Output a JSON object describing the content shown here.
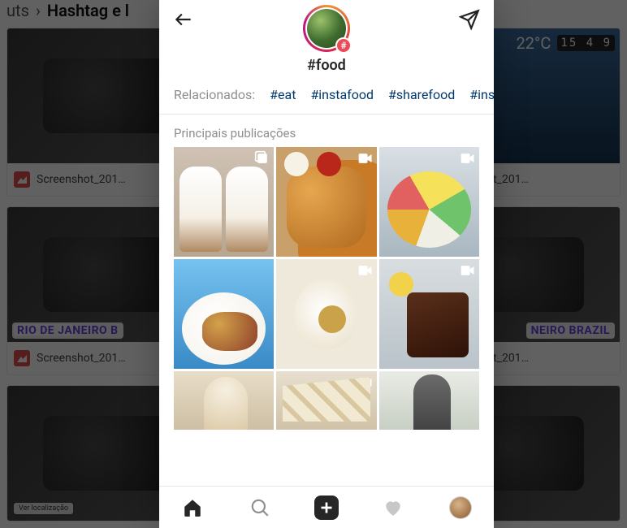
{
  "background": {
    "breadcrumb_prev": "uts",
    "breadcrumb_sep": "›",
    "breadcrumb_current": "Hashtag e l",
    "weather_temp": "22°C",
    "clock": "15 4 9",
    "card_filename": "Screenshot_201…",
    "card_filename_right": "reenshot_201…",
    "loc_label": "Ver localização",
    "rio_label": "RIO DE JANEIRO B"
  },
  "hashtag": {
    "title": "#food",
    "badge": "#"
  },
  "related": {
    "label": "Relacionados:",
    "tags": [
      "#eat",
      "#instafood",
      "#sharefood",
      "#inst"
    ]
  },
  "section_title": "Principais publicações",
  "posts": [
    {
      "name": "post-girls",
      "badge": "carousel"
    },
    {
      "name": "post-nuggets",
      "badge": "video"
    },
    {
      "name": "post-palette",
      "badge": "video"
    },
    {
      "name": "post-charcuterie",
      "badge": "none"
    },
    {
      "name": "post-dough",
      "badge": "video"
    },
    {
      "name": "post-chocolate",
      "badge": "video"
    },
    {
      "name": "post-icecream",
      "badge": "none"
    },
    {
      "name": "post-pastry",
      "badge": "video"
    },
    {
      "name": "post-fitness",
      "badge": "none"
    }
  ],
  "nav": {
    "home": "home",
    "search": "search",
    "add": "add",
    "activity": "activity",
    "profile": "profile"
  }
}
